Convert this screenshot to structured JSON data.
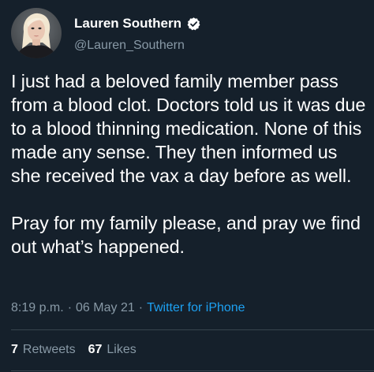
{
  "user": {
    "display_name": "Lauren Southern",
    "handle": "@Lauren_Southern",
    "verified_icon": "verified-badge-icon"
  },
  "tweet": {
    "text": "I just had a beloved family member pass from a blood clot. Doctors told us it was due to a blood thinning medication. None of this made any sense. They then informed us she received the vax a day before as well.\n\nPray for my family please, and pray we find out what’s happened."
  },
  "meta": {
    "time": "8:19 p.m.",
    "separator": "·",
    "date": "06 May 21",
    "source": "Twitter for iPhone"
  },
  "stats": {
    "retweets_count": "7",
    "retweets_label": "Retweets",
    "likes_count": "67",
    "likes_label": "Likes"
  },
  "colors": {
    "background": "#15202b",
    "text": "#ffffff",
    "secondary": "#8899a6",
    "accent": "#1da1f2",
    "divider": "#38444d"
  }
}
